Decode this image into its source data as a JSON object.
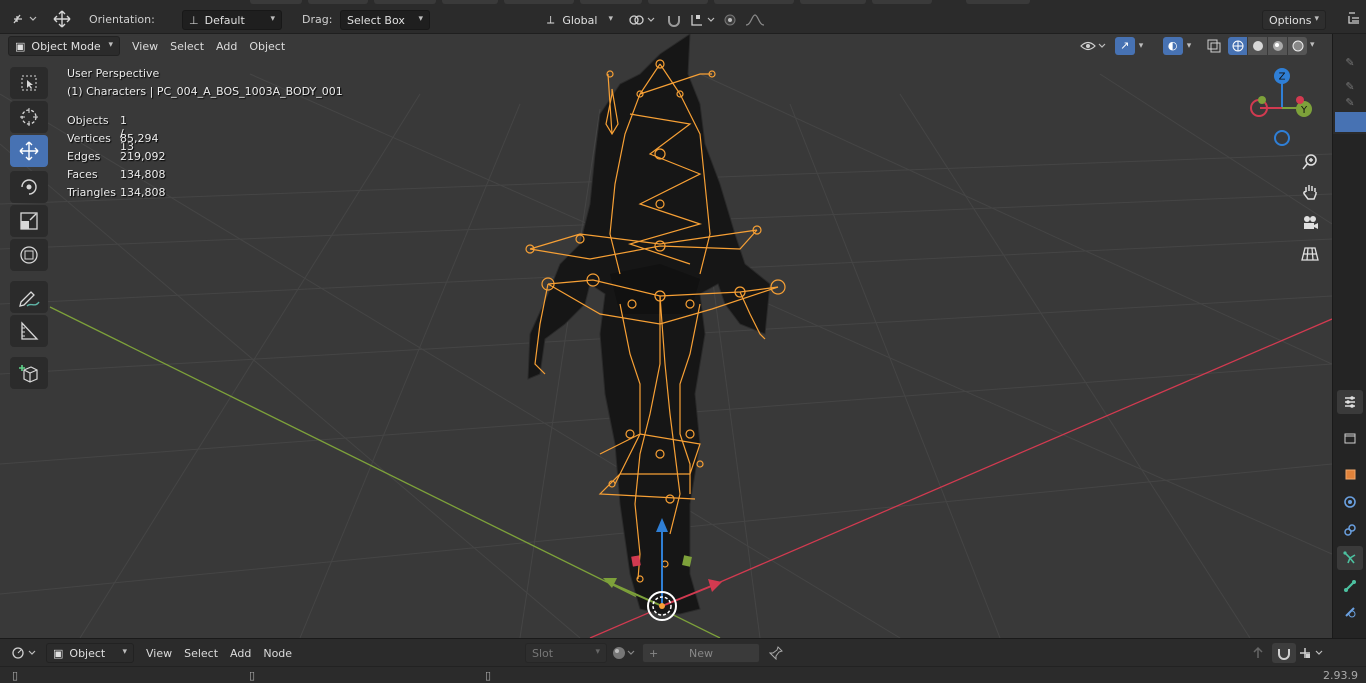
{
  "header": {
    "orientation_label": "Orientation:",
    "orientation_value": "Default",
    "drag_label": "Drag:",
    "drag_value": "Select Box",
    "transform_space": "Global",
    "options_label": "Options"
  },
  "viewport": {
    "mode_label": "Object Mode",
    "menu": [
      "View",
      "Select",
      "Add",
      "Object"
    ],
    "perspective": "User Perspective",
    "active_object": "(1) Characters | PC_004_A_BOS_1003A_BODY_001",
    "stats": [
      {
        "label": "Objects",
        "value": "1 / 13"
      },
      {
        "label": "Vertices",
        "value": "85,294"
      },
      {
        "label": "Edges",
        "value": "219,092"
      },
      {
        "label": "Faces",
        "value": "134,808"
      },
      {
        "label": "Triangles",
        "value": "134,808"
      }
    ],
    "gizmo_axes": {
      "x": "X",
      "y": "Y",
      "z": "Z"
    }
  },
  "tools": [
    {
      "name": "select-box-tool",
      "icon": "select-box-icon"
    },
    {
      "name": "cursor-tool",
      "icon": "cursor-icon"
    },
    {
      "name": "move-tool",
      "icon": "move-icon",
      "active": true
    },
    {
      "name": "rotate-tool",
      "icon": "rotate-icon"
    },
    {
      "name": "scale-tool",
      "icon": "scale-icon"
    },
    {
      "name": "transform-tool",
      "icon": "transform-icon"
    },
    {
      "name": "annotate-tool",
      "icon": "annotate-icon"
    },
    {
      "name": "measure-tool",
      "icon": "measure-icon"
    },
    {
      "name": "add-cube-tool",
      "icon": "add-cube-icon"
    }
  ],
  "node_editor": {
    "type_value": "Object",
    "menu": [
      "View",
      "Select",
      "Add",
      "Node"
    ],
    "slot_label": "Slot",
    "new_label": "New"
  },
  "status": {
    "version": "2.93.9"
  },
  "colors": {
    "accent": "#4772b3",
    "armature": "#f7a035",
    "x_axis": "#d23a50",
    "y_axis": "#7da13a",
    "z_axis": "#2f7fd6"
  }
}
